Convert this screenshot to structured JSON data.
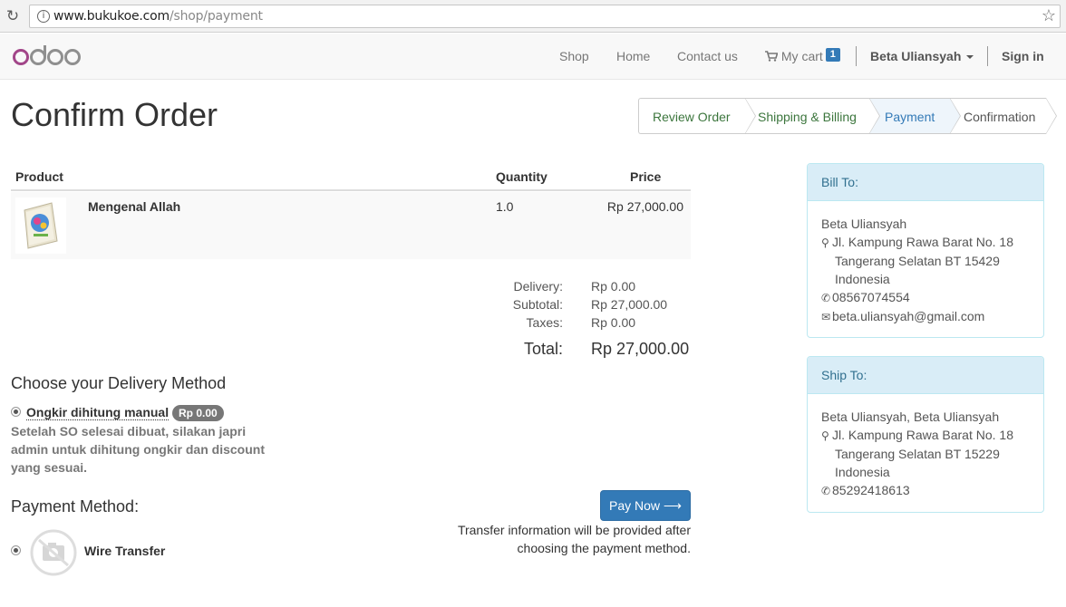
{
  "browser": {
    "url_host": "www.bukukoe.com",
    "url_path": "/shop/payment"
  },
  "navbar": {
    "logo_text": "odoo",
    "links": [
      "Shop",
      "Home",
      "Contact us"
    ],
    "cart_label": "My cart",
    "cart_count": "1",
    "user_name": "Beta Uliansyah",
    "sign_in": "Sign in"
  },
  "page": {
    "title": "Confirm Order"
  },
  "wizard": {
    "steps": [
      "Review Order",
      "Shipping & Billing",
      "Payment",
      "Confirmation"
    ],
    "active_step": "Payment"
  },
  "order_table": {
    "headers": [
      "Product",
      "Quantity",
      "Price"
    ],
    "rows": [
      {
        "product": "Mengenal Allah",
        "quantity": "1.0",
        "price": "Rp 27,000.00"
      }
    ]
  },
  "totals": {
    "delivery_label": "Delivery:",
    "delivery_value": "Rp 0.00",
    "subtotal_label": "Subtotal:",
    "subtotal_value": "Rp 27,000.00",
    "taxes_label": "Taxes:",
    "taxes_value": "Rp 0.00",
    "total_label": "Total:",
    "total_value": "Rp 27,000.00"
  },
  "delivery": {
    "heading": "Choose your Delivery Method",
    "method_name": "Ongkir dihitung manual",
    "method_price": "Rp 0.00",
    "description": "Setelah SO selesai dibuat, silakan japri admin untuk dihitung ongkir dan discount yang sesuai."
  },
  "payment": {
    "heading": "Payment Method:",
    "method_name": "Wire Transfer",
    "pay_button": "Pay Now",
    "note": "Transfer information will be provided after choosing the payment method."
  },
  "bill_to": {
    "heading": "Bill To:",
    "name": "Beta Uliansyah",
    "address1": "Jl. Kampung Rawa Barat No. 18",
    "address2": "Tangerang Selatan BT 15429",
    "country": "Indonesia",
    "phone": "08567074554",
    "email": "beta.uliansyah@gmail.com"
  },
  "ship_to": {
    "heading": "Ship To:",
    "name": "Beta Uliansyah, Beta Uliansyah",
    "address1": "Jl. Kampung Rawa Barat No. 18",
    "address2": "Tangerang Selatan BT 15229",
    "country": "Indonesia",
    "phone": "85292418613"
  },
  "colors": {
    "primary": "#337ab7",
    "wizard_active": "#eef5fb",
    "wizard_text": "#3c763d",
    "panel_head_bg": "#d9edf7",
    "panel_head_text": "#31708f",
    "logo_purple": "#a24689",
    "logo_gray": "#8f8f8f"
  },
  "icons": {
    "reload": "reload-icon",
    "star": "bookmark-star-icon",
    "cart": "shopping-cart-icon",
    "map_marker": "map-marker-icon",
    "phone": "phone-icon",
    "envelope": "envelope-icon",
    "no_image": "no-camera-icon"
  }
}
